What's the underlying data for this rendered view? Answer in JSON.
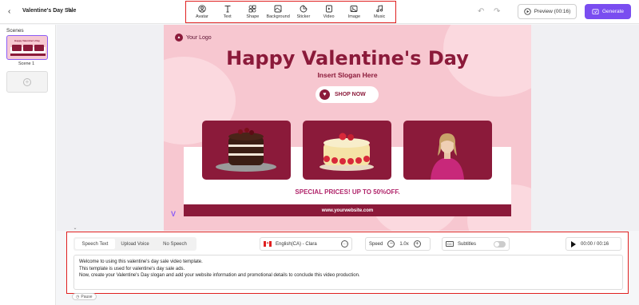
{
  "header": {
    "project_title": "Valentine's Day Sale",
    "preview_label": "Preview (00:16)",
    "generate_label": "Generate"
  },
  "toolbar": {
    "items": [
      {
        "label": "Avatar",
        "icon": "avatar-icon"
      },
      {
        "label": "Text",
        "icon": "text-icon"
      },
      {
        "label": "Shape",
        "icon": "shape-icon"
      },
      {
        "label": "Background",
        "icon": "background-icon"
      },
      {
        "label": "Sticker",
        "icon": "sticker-icon"
      },
      {
        "label": "Video",
        "icon": "video-icon"
      },
      {
        "label": "Image",
        "icon": "image-icon"
      },
      {
        "label": "Music",
        "icon": "music-icon"
      }
    ]
  },
  "sidebar": {
    "scenes_label": "Scenes",
    "scenes": [
      {
        "name": "Scene 1"
      }
    ]
  },
  "slide": {
    "logo_text": "Your Logo",
    "title": "Happy Valentine's Day",
    "slogan": "Insert Slogan Here",
    "shop_label": "SHOP NOW",
    "promo": "SPECIAL PRICES! UP TO 50%OFF.",
    "website": "www.yourwebsite.com",
    "colors": {
      "background": "#f7c7d0",
      "accent": "#8b1a3a",
      "promo": "#b0246a"
    }
  },
  "panel": {
    "tabs": [
      {
        "label": "Speech Text",
        "active": true
      },
      {
        "label": "Upload Voice",
        "active": false
      },
      {
        "label": "No Speech",
        "active": false
      }
    ],
    "voice": "English(CA) - Clara",
    "speed_label": "Speed",
    "speed_value": "1.0x",
    "subtitles_label": "Subtitles",
    "subtitles_on": false,
    "time": "00:00 / 00:16",
    "script_lines": [
      "Welcome to using this valentine's day sale video template.",
      "This template is used for valentine's day sale ads.",
      "Now, create your Valentine's Day slogan and add your website information and promotional details to conclude this video production."
    ],
    "pause_label": "Pause"
  },
  "accent_color": "#7a4df0"
}
